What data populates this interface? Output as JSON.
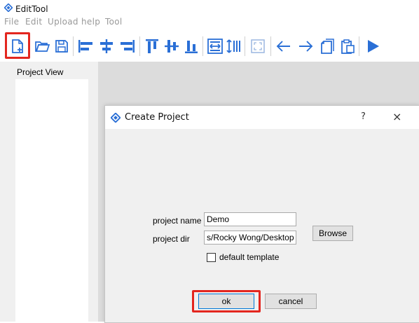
{
  "app": {
    "title": "EditTool"
  },
  "menu": [
    "File",
    "Edit",
    "Upload",
    "help",
    "Tool"
  ],
  "toolbar": {
    "icons": [
      "new-project-icon",
      "open-folder-icon",
      "save-icon",
      "align-left-icon",
      "align-center-icon",
      "align-right-icon",
      "align-top-icon",
      "align-middle-icon",
      "align-bottom-icon",
      "same-width-icon",
      "same-height-icon",
      "fit-screen-icon",
      "arrow-left-icon",
      "arrow-right-icon",
      "copy-icon",
      "paste-icon",
      "run-icon"
    ],
    "highlighted": "new-project-icon",
    "accent_color": "#2a6fd6",
    "highlight_color": "#e3261f"
  },
  "sidebar": {
    "label": "Project View"
  },
  "dialog": {
    "title": "Create Project",
    "help_glyph": "?",
    "close_glyph": "×",
    "project_name_label": "project name",
    "project_name_value": "Demo",
    "project_dir_label": "project dir",
    "project_dir_value": "s/Rocky Wong/Desktop",
    "browse_label": "Browse",
    "default_template_label": "default template",
    "default_template_checked": false,
    "ok_label": "ok",
    "cancel_label": "cancel"
  }
}
